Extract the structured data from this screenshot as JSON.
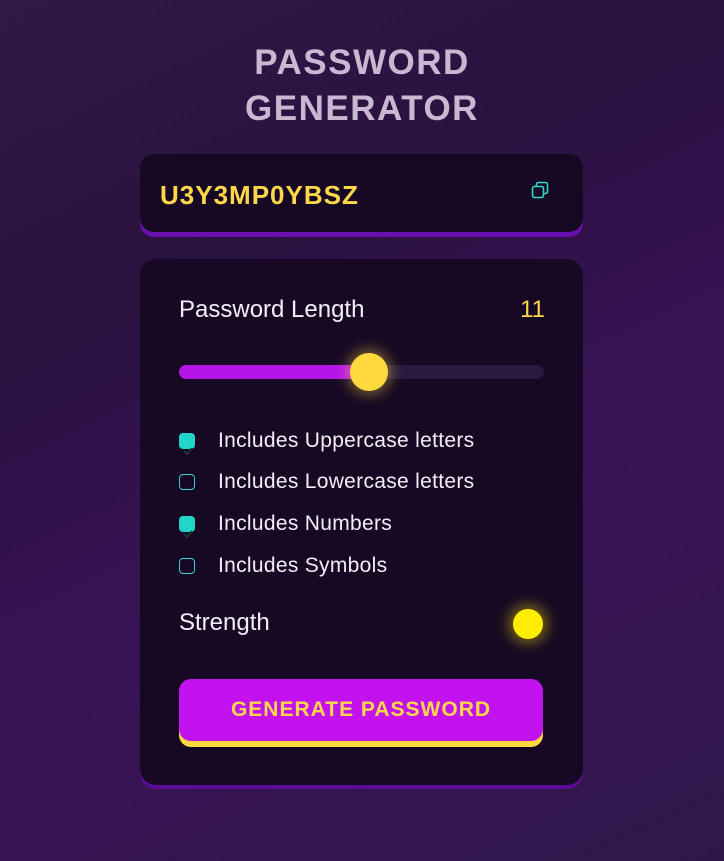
{
  "header": {
    "title_line1": "PASSWORD",
    "title_line2": "GENERATOR"
  },
  "output": {
    "password": "U3Y3MP0YBSZ",
    "copy_icon": "copy-icon"
  },
  "length": {
    "label": "Password Length",
    "value": "11",
    "slider_fraction": 0.52
  },
  "options": [
    {
      "label": "Includes Uppercase letters",
      "checked": true
    },
    {
      "label": "Includes Lowercase letters",
      "checked": false
    },
    {
      "label": "Includes Numbers",
      "checked": true
    },
    {
      "label": "Includes Symbols",
      "checked": false
    }
  ],
  "strength": {
    "label": "Strength",
    "indicator_color": "#ffee00"
  },
  "generate": {
    "label": "GENERATE PASSWORD"
  },
  "colors": {
    "accent_yellow": "#ffd84a",
    "accent_purple": "#c112ef",
    "checkbox_teal": "#1fd6c8"
  }
}
